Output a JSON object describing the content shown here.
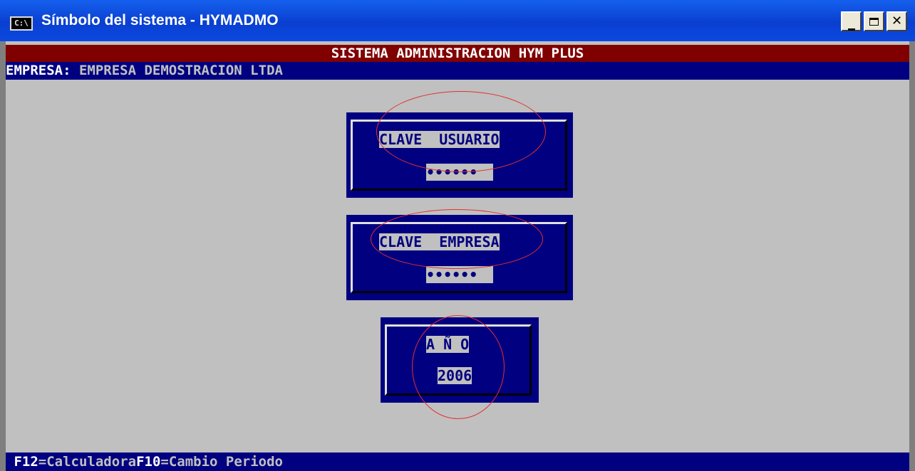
{
  "window": {
    "title": "Símbolo del sistema - HYMADMO",
    "icon": "C:\\",
    "buttons": [
      "minimize",
      "maximize",
      "close"
    ]
  },
  "app": {
    "title": "SISTEMA ADMINISTRACION HYM PLUS",
    "company_label": "EMPRESA:",
    "company_value": "EMPRESA DEMOSTRACION LTDA"
  },
  "fields": {
    "user_password": {
      "label": "CLAVE  USUARIO",
      "value": "••••••"
    },
    "company_password": {
      "label": "CLAVE  EMPRESA",
      "value": "••••••"
    },
    "year": {
      "label": "A Ñ O",
      "value": "2006"
    }
  },
  "footer": [
    {
      "key": "F12",
      "text": "=Calculadora"
    },
    {
      "key": "F10",
      "text": "=Cambio Periodo"
    }
  ],
  "colors": {
    "title_bar": "#0a3fd0",
    "header_red": "#800000",
    "console_blue": "#000080",
    "console_gray": "#c0c0c0",
    "annotation": "#e23030"
  }
}
